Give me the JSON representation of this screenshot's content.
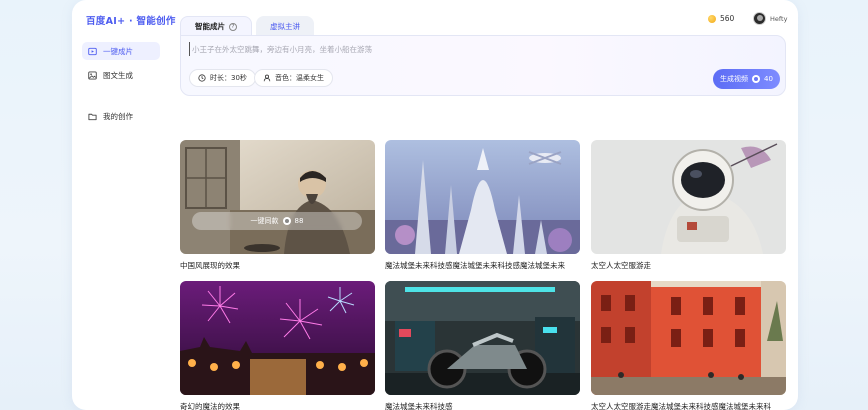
{
  "brand": {
    "logo_text": "百度AI+ · 智能创作",
    "accent": "#4d5cf0"
  },
  "sidebar": {
    "items": [
      {
        "label": "一键成片",
        "icon": "film-icon",
        "active": true
      },
      {
        "label": "图文生成",
        "icon": "image-icon",
        "active": false
      },
      {
        "label": "我的创作",
        "icon": "folder-icon",
        "active": false
      }
    ]
  },
  "header": {
    "coins": "560",
    "user_name": "Hefty"
  },
  "tabs": [
    {
      "label": "智能成片",
      "active": true,
      "help": "?"
    },
    {
      "label": "虚拟主讲",
      "active": false
    }
  ],
  "prompt": {
    "placeholder": "小王子在外太空跳舞，旁边有小月亮，坐着小船在游荡",
    "duration_label": "时长：30秒",
    "voice_label": "音色：温柔女生",
    "generate_label": "生成视频",
    "generate_cost": "40"
  },
  "cards": [
    {
      "caption": "中国风展现的效果",
      "overlay_label": "一键同款",
      "overlay_cost": "88"
    },
    {
      "caption": "魔法城堡未来科技感魔法城堡未来科技感魔法城堡未来"
    },
    {
      "caption": "太空人太空服游走"
    },
    {
      "caption": "奇幻的魔法的效果"
    },
    {
      "caption": "魔法城堡未来科技感"
    },
    {
      "caption": "太空人太空服游走魔法城堡未来科技感魔法城堡未来科"
    }
  ]
}
